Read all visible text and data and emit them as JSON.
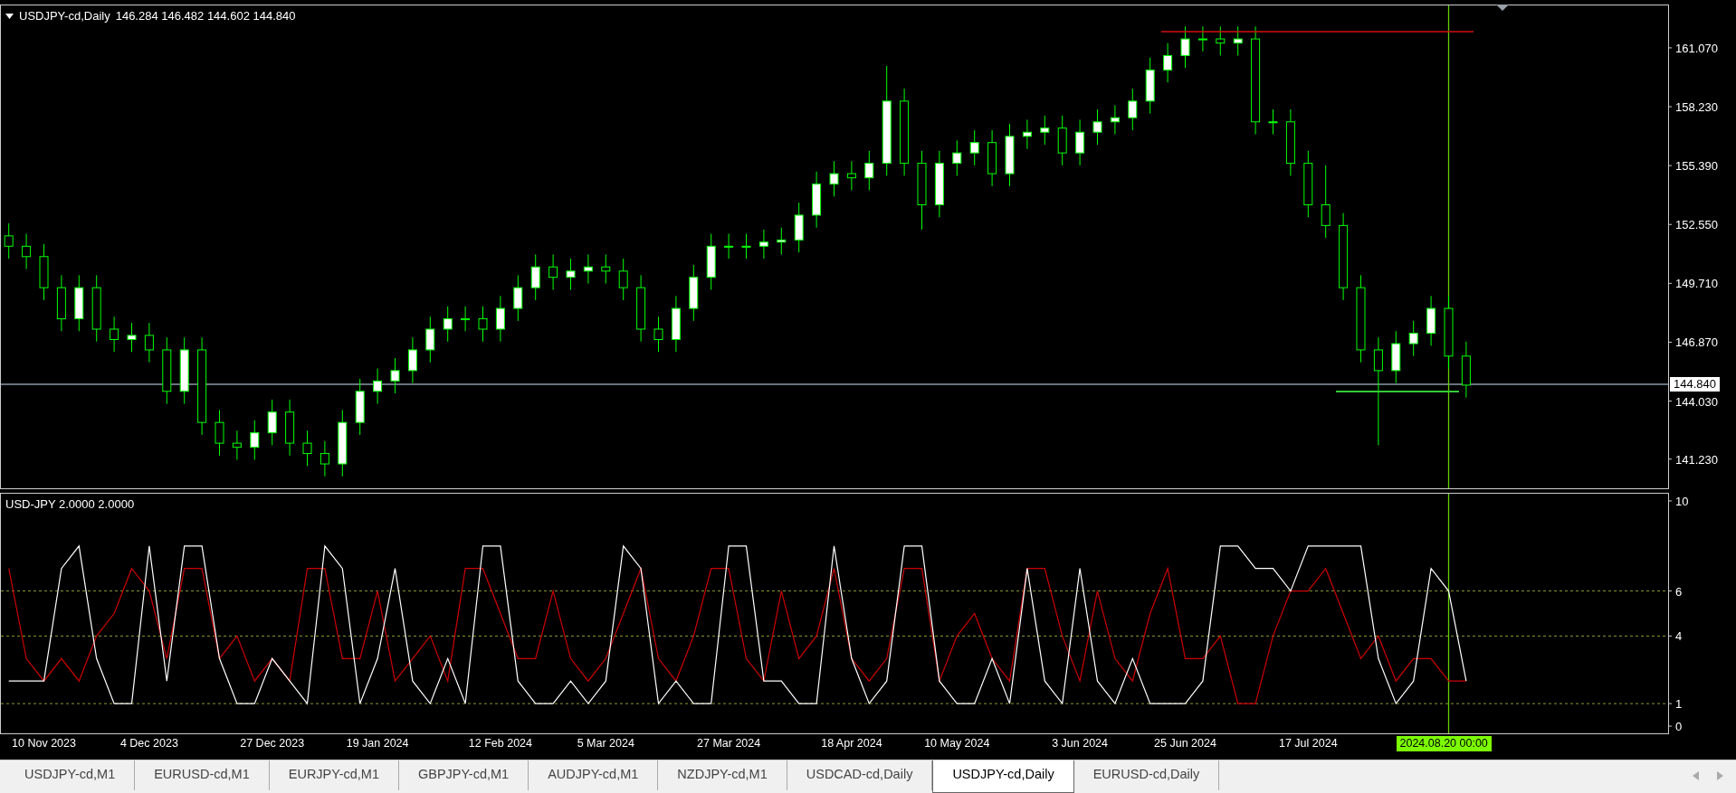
{
  "price_chart": {
    "header": {
      "symbol": "USDJPY-cd,Daily",
      "ohlc": "146.284 146.482 144.602 144.840"
    },
    "chart_data": {
      "type": "candlestick",
      "ylim": [
        139.78,
        163.16
      ],
      "categories": [
        null,
        null,
        null,
        null,
        null,
        null,
        null,
        null,
        null,
        null,
        null,
        null,
        null,
        null,
        null,
        null,
        null,
        null,
        null,
        null,
        null,
        null,
        null,
        null,
        null,
        null,
        null,
        null,
        null,
        null,
        null,
        null,
        null,
        null,
        null,
        null,
        null,
        null,
        null,
        null,
        null,
        null,
        null,
        null,
        null,
        null,
        null,
        null,
        null,
        null,
        null,
        null,
        null,
        null,
        null,
        null,
        null,
        null,
        null,
        null,
        null,
        null,
        null,
        null,
        null,
        null,
        null,
        null,
        null,
        null,
        null,
        null,
        null,
        null,
        null,
        null,
        null,
        null,
        null,
        null,
        null,
        null,
        null,
        null,
        null,
        null,
        null,
        null,
        null,
        null,
        null,
        null,
        null,
        null,
        null
      ],
      "ohlc": [
        [
          152,
          152.6,
          150.9,
          151.5
        ],
        [
          151.5,
          152.1,
          150.4,
          151
        ],
        [
          151,
          151.6,
          148.9,
          149.5
        ],
        [
          149.5,
          150.1,
          147.4,
          148
        ],
        [
          148,
          150.1,
          147.4,
          149.5
        ],
        [
          149.5,
          150.1,
          146.9,
          147.5
        ],
        [
          147.5,
          148.1,
          146.4,
          147
        ],
        [
          147,
          147.8,
          146.4,
          147.2
        ],
        [
          147.2,
          147.8,
          145.9,
          146.5
        ],
        [
          146.5,
          147.1,
          143.9,
          144.5
        ],
        [
          144.5,
          147.1,
          143.9,
          146.5
        ],
        [
          146.5,
          147.1,
          142.4,
          143
        ],
        [
          143,
          143.6,
          141.4,
          142
        ],
        [
          142,
          142.6,
          141.2,
          141.8
        ],
        [
          141.8,
          143.1,
          141.2,
          142.5
        ],
        [
          142.5,
          144.1,
          141.9,
          143.5
        ],
        [
          143.5,
          144.1,
          141.4,
          142
        ],
        [
          142,
          142.6,
          140.9,
          141.5
        ],
        [
          141.5,
          142.1,
          140.4,
          141
        ],
        [
          141,
          143.6,
          140.4,
          143
        ],
        [
          143,
          145.1,
          142.4,
          144.5
        ],
        [
          144.5,
          145.6,
          143.9,
          145
        ],
        [
          145,
          146.1,
          144.4,
          145.5
        ],
        [
          145.5,
          147.1,
          144.9,
          146.5
        ],
        [
          146.5,
          148.1,
          145.9,
          147.5
        ],
        [
          147.5,
          148.6,
          146.9,
          148
        ],
        [
          148,
          148.6,
          147.4,
          148
        ],
        [
          148,
          148.6,
          146.9,
          147.5
        ],
        [
          147.5,
          149.1,
          146.9,
          148.5
        ],
        [
          148.5,
          150.1,
          147.9,
          149.5
        ],
        [
          149.5,
          151.1,
          148.9,
          150.5
        ],
        [
          150.5,
          151.1,
          149.4,
          150
        ],
        [
          150,
          150.9,
          149.4,
          150.3
        ],
        [
          150.3,
          151.1,
          149.7,
          150.5
        ],
        [
          150.5,
          151.1,
          149.7,
          150.3
        ],
        [
          150.3,
          150.9,
          148.9,
          149.5
        ],
        [
          149.5,
          150.1,
          146.9,
          147.5
        ],
        [
          147.5,
          148.1,
          146.4,
          147
        ],
        [
          147,
          149.1,
          146.4,
          148.5
        ],
        [
          148.5,
          150.6,
          147.9,
          150
        ],
        [
          150,
          152.1,
          149.4,
          151.5
        ],
        [
          151.5,
          152.1,
          150.9,
          151.5
        ],
        [
          151.5,
          152.1,
          150.9,
          151.5
        ],
        [
          151.5,
          152.3,
          150.9,
          151.7
        ],
        [
          151.7,
          152.4,
          151.1,
          151.8
        ],
        [
          151.8,
          153.6,
          151.2,
          153
        ],
        [
          153,
          155.1,
          152.4,
          154.5
        ],
        [
          154.5,
          155.6,
          153.9,
          155
        ],
        [
          155,
          155.6,
          154.2,
          154.8
        ],
        [
          154.8,
          156.1,
          154.2,
          155.5
        ],
        [
          155.5,
          160.2,
          154.9,
          158.5
        ],
        [
          158.5,
          159.1,
          154.9,
          155.5
        ],
        [
          155.5,
          156.1,
          152.3,
          153.5
        ],
        [
          153.5,
          156.1,
          152.9,
          155.5
        ],
        [
          155.5,
          156.6,
          154.9,
          156
        ],
        [
          156,
          157.1,
          155.4,
          156.5
        ],
        [
          156.5,
          157.1,
          154.4,
          155
        ],
        [
          155,
          157.4,
          154.4,
          156.8
        ],
        [
          156.8,
          157.6,
          156.2,
          157
        ],
        [
          157,
          157.8,
          156.4,
          157.2
        ],
        [
          157.2,
          157.8,
          155.4,
          156
        ],
        [
          156,
          157.6,
          155.4,
          157
        ],
        [
          157,
          158.1,
          156.4,
          157.5
        ],
        [
          157.5,
          158.3,
          156.9,
          157.7
        ],
        [
          157.7,
          159.1,
          157.1,
          158.5
        ],
        [
          158.5,
          160.6,
          157.9,
          160
        ],
        [
          160,
          161.3,
          159.4,
          160.7
        ],
        [
          160.7,
          162.1,
          160.1,
          161.5
        ],
        [
          161.5,
          162.1,
          160.9,
          161.5
        ],
        [
          161.5,
          162.1,
          160.7,
          161.3
        ],
        [
          161.3,
          162.1,
          160.7,
          161.5
        ],
        [
          161.5,
          162.1,
          156.9,
          157.5
        ],
        [
          157.5,
          158.1,
          156.9,
          157.5
        ],
        [
          157.5,
          158.1,
          154.9,
          155.5
        ],
        [
          155.5,
          156.1,
          152.9,
          153.5
        ],
        [
          153.5,
          155.4,
          151.9,
          152.5
        ],
        [
          152.5,
          153.1,
          148.9,
          149.5
        ],
        [
          149.5,
          150.1,
          145.9,
          146.5
        ],
        [
          146.5,
          147.1,
          141.9,
          145.5
        ],
        [
          145.5,
          147.4,
          144.9,
          146.8
        ],
        [
          146.8,
          147.9,
          146.2,
          147.3
        ],
        [
          147.3,
          149.1,
          146.7,
          148.5
        ],
        [
          148.5,
          149.1,
          145.6,
          146.2
        ],
        [
          146.2,
          146.9,
          144.2,
          144.8
        ],
        null,
        null,
        null,
        null,
        null,
        null,
        null,
        null,
        null,
        null,
        null
      ],
      "yticks": [
        {
          "value": 161.07,
          "label": "161.070"
        },
        {
          "value": 158.23,
          "label": "158.230"
        },
        {
          "value": 155.39,
          "label": "155.390"
        },
        {
          "value": 152.55,
          "label": "152.550"
        },
        {
          "value": 149.71,
          "label": "149.710"
        },
        {
          "value": 146.87,
          "label": "146.870"
        },
        {
          "value": 144.03,
          "label": "144.030"
        },
        {
          "value": 141.23,
          "label": "141.230"
        }
      ],
      "ref_lines": [
        {
          "axis": "y",
          "value": 144.84,
          "label": "144.840",
          "color": "#8a9aa8"
        }
      ]
    }
  },
  "indicator": {
    "header": "USD-JPY 2.0000 2.0000",
    "chart_data": {
      "type": "line",
      "ylim": [
        -0.36,
        10.36
      ],
      "grid": true,
      "categories": [
        null,
        null,
        "10 Nov 2023",
        null,
        null,
        null,
        null,
        null,
        "4 Dec 2023",
        null,
        null,
        null,
        null,
        null,
        null,
        "27 Dec 2023",
        null,
        null,
        null,
        null,
        null,
        "19 Jan 2024",
        null,
        null,
        null,
        null,
        null,
        null,
        "12 Feb 2024",
        null,
        null,
        null,
        null,
        null,
        "5 Mar 2024",
        null,
        null,
        null,
        null,
        null,
        null,
        "27 Mar 2024",
        null,
        null,
        null,
        null,
        null,
        null,
        "18 Apr 2024",
        null,
        null,
        null,
        null,
        null,
        "10 May 2024",
        null,
        null,
        null,
        null,
        null,
        null,
        "3 Jun 2024",
        null,
        null,
        null,
        null,
        null,
        "25 Jun 2024",
        null,
        null,
        null,
        null,
        null,
        null,
        "17 Jul 2024",
        null,
        null,
        null,
        null,
        null,
        null,
        null,
        "2024.08.20 00:00",
        null,
        null,
        null,
        null,
        null,
        null,
        null,
        null,
        null,
        null,
        null,
        null
      ],
      "series": [
        {
          "color": "#ffffff",
          "values": [
            2,
            2,
            2,
            7,
            8,
            3,
            1,
            1,
            8,
            2,
            8,
            8,
            3,
            1,
            1,
            3,
            2,
            1,
            8,
            7,
            1,
            3,
            7,
            2,
            1,
            3,
            1,
            8,
            8,
            2,
            1,
            1,
            2,
            1,
            2,
            8,
            7,
            1,
            2,
            1,
            1,
            8,
            8,
            2,
            2,
            1,
            1,
            8,
            3,
            1,
            2,
            8,
            8,
            2,
            1,
            1,
            3,
            1,
            7,
            2,
            1,
            7,
            2,
            1,
            3,
            1,
            1,
            1,
            2,
            8,
            8,
            7,
            7,
            6,
            8,
            8,
            8,
            8,
            3,
            1,
            2,
            7,
            6,
            2,
            null,
            null,
            null,
            null,
            null,
            null,
            null,
            null,
            null,
            null,
            null
          ]
        },
        {
          "color": "#cc0000",
          "values": [
            7,
            3,
            2,
            3,
            2,
            4,
            5,
            7,
            6,
            3,
            7,
            7,
            3,
            4,
            2,
            3,
            2,
            7,
            7,
            3,
            3,
            6,
            2,
            3,
            4,
            2,
            7,
            7,
            5,
            3,
            3,
            6,
            3,
            2,
            3,
            5,
            7,
            3,
            2,
            4,
            7,
            7,
            3,
            2,
            6,
            3,
            4,
            7,
            3,
            2,
            3,
            7,
            7,
            2,
            4,
            5,
            3,
            2,
            7,
            7,
            4,
            2,
            6,
            3,
            2,
            5,
            7,
            3,
            3,
            4,
            1,
            1,
            4,
            6,
            6,
            7,
            5,
            3,
            4,
            2,
            3,
            3,
            2,
            2,
            null,
            null,
            null,
            null,
            null,
            null,
            null,
            null,
            null,
            null,
            null
          ]
        }
      ],
      "yticks": [
        {
          "value": 10,
          "label": "10"
        },
        {
          "value": 6,
          "label": "6"
        },
        {
          "value": 4,
          "label": "4"
        },
        {
          "value": 1,
          "label": "1"
        },
        {
          "value": 0,
          "label": "0"
        }
      ],
      "ref_lines": [
        {
          "axis": "x",
          "value": "2024.08.20 00:00",
          "color": "#66cc00"
        }
      ]
    }
  },
  "tabs": [
    {
      "label": "USDJPY-cd,M1",
      "selected": false
    },
    {
      "label": "EURUSD-cd,M1",
      "selected": false
    },
    {
      "label": "EURJPY-cd,M1",
      "selected": false
    },
    {
      "label": "GBPJPY-cd,M1",
      "selected": false
    },
    {
      "label": "AUDJPY-cd,M1",
      "selected": false
    },
    {
      "label": "NZDJPY-cd,M1",
      "selected": false
    },
    {
      "label": "USDCAD-cd,Daily",
      "selected": false
    },
    {
      "label": "USDJPY-cd,Daily",
      "selected": true
    },
    {
      "label": "EURUSD-cd,Daily",
      "selected": false
    }
  ]
}
